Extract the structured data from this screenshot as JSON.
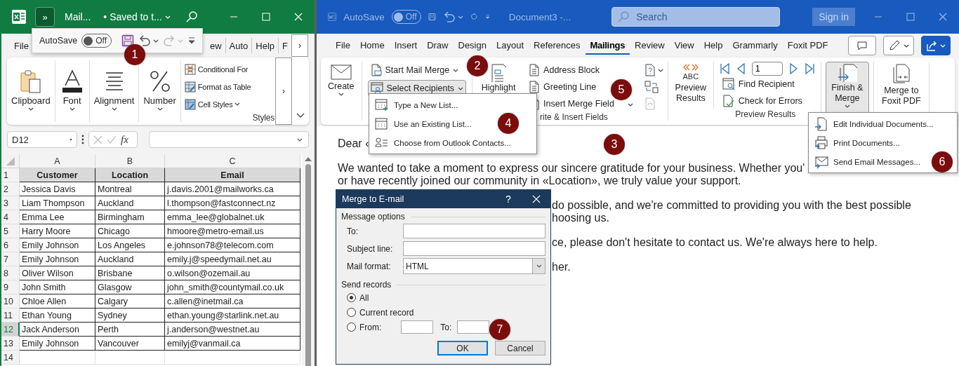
{
  "excel": {
    "title_bar": {
      "more_button": "»",
      "file_name": "Mail...",
      "save_status": "• Saved to t..."
    },
    "quick_access": {
      "autosave_label": "AutoSave",
      "autosave": {
        "label": "Off",
        "on": false
      }
    },
    "tabs": [
      {
        "label": "File"
      },
      {
        "label": "ew"
      },
      {
        "label": "Auto"
      },
      {
        "label": "Help"
      },
      {
        "label": "F"
      }
    ],
    "tabs_scroll": "›",
    "ribbon_groups": [
      {
        "label": "Clipboard",
        "kind": "clipboard"
      },
      {
        "label": "Font",
        "kind": "font"
      },
      {
        "label": "Alignment",
        "kind": "alignment"
      },
      {
        "label": "Number",
        "kind": "number"
      }
    ],
    "styles_group": {
      "items": [
        {
          "label": "Conditional For",
          "kind": "conditional",
          "dropdown": false
        },
        {
          "label": "Format as Table",
          "kind": "table",
          "dropdown": false
        },
        {
          "label": "Cell Styles",
          "kind": "cellstyles",
          "dropdown": true
        }
      ],
      "label": "Styles"
    },
    "ribbon_scroll": "›",
    "formula_bar": {
      "name_box": "D12",
      "fx": "fx"
    },
    "sheet": {
      "columns": [
        "A",
        "B",
        "C"
      ],
      "rows": [
        {
          "number": "1",
          "kind": "header",
          "selected": false,
          "cells": [
            "Customer",
            "Location",
            "Email"
          ]
        },
        {
          "number": "2",
          "kind": "data",
          "selected": false,
          "cells": [
            "Jessica Davis",
            "Montreal",
            "j.davis.2001@mailworks.ca"
          ]
        },
        {
          "number": "3",
          "kind": "data",
          "selected": false,
          "cells": [
            "Liam Thompson",
            "Auckland",
            "l.thompson@fastconnect.nz"
          ]
        },
        {
          "number": "4",
          "kind": "data",
          "selected": false,
          "cells": [
            "Emma Lee",
            "Birmingham",
            "emma_lee@globalnet.uk"
          ]
        },
        {
          "number": "5",
          "kind": "data",
          "selected": false,
          "cells": [
            "Harry Moore",
            "Chicago",
            "hmoore@metro-email.us"
          ]
        },
        {
          "number": "6",
          "kind": "data",
          "selected": false,
          "cells": [
            "Emily Johnson",
            "Los Angeles",
            "e.johnson78@telecom.com"
          ]
        },
        {
          "number": "7",
          "kind": "data",
          "selected": false,
          "cells": [
            "Emily Johnson",
            "Auckland",
            "emily.j@speedymail.net.au"
          ]
        },
        {
          "number": "8",
          "kind": "data",
          "selected": false,
          "cells": [
            "Oliver Wilson",
            "Brisbane",
            "o.wilson@ozemail.au"
          ]
        },
        {
          "number": "9",
          "kind": "data",
          "selected": false,
          "cells": [
            "John Smith",
            "Glasgow",
            "john_smith@countymail.co.uk"
          ]
        },
        {
          "number": "10",
          "kind": "data",
          "selected": false,
          "cells": [
            "Chloe Allen",
            "Calgary",
            "c.allen@inetmail.ca"
          ]
        },
        {
          "number": "11",
          "kind": "data",
          "selected": false,
          "cells": [
            "Ethan Young",
            "Sydney",
            "ethan.young@starlink.net.au"
          ]
        },
        {
          "number": "12",
          "kind": "data",
          "selected": true,
          "cells": [
            "Jack Anderson",
            "Perth",
            "j.anderson@westnet.au"
          ]
        },
        {
          "number": "13",
          "kind": "data",
          "selected": false,
          "cells": [
            "Emily Johnson",
            "Vancouver",
            "emilyj@vanmail.ca"
          ]
        },
        {
          "number": "14",
          "kind": "empty",
          "selected": false,
          "cells": []
        }
      ]
    }
  },
  "word": {
    "title_bar": {
      "autosave_label": "AutoSave",
      "autosave": {
        "label": "Off",
        "on": false
      },
      "document": "Document3 -...",
      "search": {
        "placeholder": "Search"
      },
      "sign_in": "Sign in"
    },
    "tabs": [
      {
        "label": "File",
        "selected": false
      },
      {
        "label": "Home",
        "selected": false
      },
      {
        "label": "Insert",
        "selected": false
      },
      {
        "label": "Draw",
        "selected": false
      },
      {
        "label": "Design",
        "selected": false
      },
      {
        "label": "Layout",
        "selected": false
      },
      {
        "label": "References",
        "selected": false
      },
      {
        "label": "Mailings",
        "selected": true
      },
      {
        "label": "Review",
        "selected": false
      },
      {
        "label": "View",
        "selected": false
      },
      {
        "label": "Help",
        "selected": false
      },
      {
        "label": "Grammarly",
        "selected": false
      },
      {
        "label": "Foxit PDF",
        "selected": false
      }
    ],
    "ribbon": {
      "create": "Create",
      "start_mail_merge": "Start Mail Merge",
      "select_recipients": {
        "label": "Select Recipients",
        "pressed": true
      },
      "highlight": "Highlight",
      "write_items": [
        "Address Block",
        "Greeting Line",
        "Insert Merge Field"
      ],
      "write_label": "rite & Insert Fields",
      "preview": {
        "icon_text": "ABC",
        "label": "Preview Results"
      },
      "record": "1",
      "preview_items": [
        "Find Recipient",
        "Check for Errors"
      ],
      "preview_group_label": "Preview Results",
      "finish": {
        "label": "Finish & Merge",
        "pressed": true
      },
      "foxit": "Merge to Foxit PDF"
    },
    "recipients_menu": [
      {
        "label": "Type a New List...",
        "kind": "new"
      },
      {
        "label": "Use an Existing List...",
        "kind": "existing"
      },
      {
        "label": "Choose from Outlook Contacts...",
        "kind": "contacts"
      }
    ],
    "finish_menu": [
      {
        "label": "Edit Individual Documents...",
        "kind": "edit"
      },
      {
        "label": "Print Documents...",
        "kind": "print"
      },
      {
        "label": "Send Email Messages...",
        "kind": "email"
      }
    ],
    "document": [
      {
        "kind": "full",
        "lines": [
          "Dear «"
        ]
      },
      {
        "kind": "full",
        "lines": [
          "We wanted to take a moment to express our sincere gratitude for your business. Whether you'",
          "or have recently joined our community in «Location», we truly value your support."
        ]
      },
      {
        "kind": "beside",
        "lines": [
          "do possible, and we're committed to providing you with the best possible",
          "hoosing us."
        ]
      },
      {
        "kind": "beside",
        "lines": [
          "ce, please don't hesitate to contact us. We're always here to help."
        ]
      },
      {
        "kind": "beside",
        "lines": [
          "her."
        ]
      }
    ]
  },
  "dialog": {
    "title": "Merge to E-mail",
    "help": "?",
    "message_options": "Message options",
    "to_label": "To:",
    "subject_label": "Subject line:",
    "format_label": "Mail format:",
    "format_value": "HTML",
    "send_records": "Send records",
    "records": [
      {
        "label": "All",
        "selected": true,
        "kind": "plain"
      },
      {
        "label": "Current record",
        "selected": false,
        "kind": "plain"
      },
      {
        "label": "From:",
        "selected": false,
        "kind": "range"
      }
    ],
    "range_to_label": "To:",
    "buttons": [
      {
        "label": "OK",
        "default": true
      },
      {
        "label": "Cancel",
        "default": false
      }
    ]
  },
  "callouts": [
    "1",
    "2",
    "3",
    "4",
    "5",
    "6",
    "7"
  ]
}
